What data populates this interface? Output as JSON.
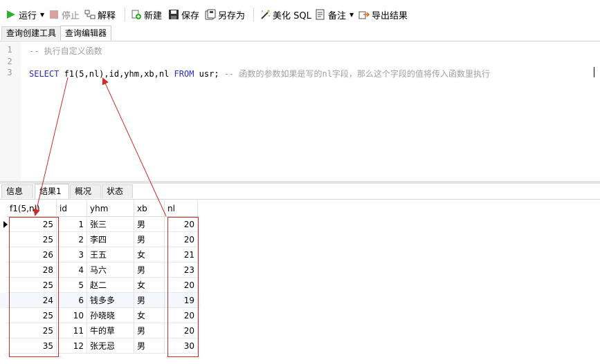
{
  "toolbar": {
    "run": "运行",
    "stop": "停止",
    "explain": "解释",
    "new": "新建",
    "save": "保存",
    "save_as": "另存为",
    "beautify": "美化 SQL",
    "notes": "备注",
    "export": "导出结果",
    "icons": [
      "play-icon",
      "stop-icon",
      "explain-icon",
      "new-icon",
      "save-icon",
      "save-as-icon",
      "wand-icon",
      "note-icon",
      "export-icon"
    ]
  },
  "editor_tabs": [
    "查询创建工具",
    "查询编辑器"
  ],
  "editor": {
    "line_numbers": [
      "1",
      "2",
      "3"
    ],
    "line1_comment": "-- 执行自定义函数",
    "line3": {
      "kw_select": "SELECT",
      "fn": " f1(",
      "arg1": "5",
      "rest": ",nl),id,yhm,xb,nl ",
      "kw_from": "FROM",
      "table": " usr; ",
      "comment": "-- 函数的参数如果是写的nl字段，那么这个字段的值将传入函数里执行"
    }
  },
  "result_tabs": [
    "信息",
    "结果1",
    "概况",
    "状态"
  ],
  "grid": {
    "columns": [
      "f1(5,nl)",
      "id",
      "yhm",
      "xb",
      "nl"
    ],
    "rows": [
      [
        "25",
        "1",
        "张三",
        "男",
        "20"
      ],
      [
        "25",
        "2",
        "李四",
        "男",
        "20"
      ],
      [
        "26",
        "3",
        "王五",
        "女",
        "21"
      ],
      [
        "28",
        "4",
        "马六",
        "男",
        "23"
      ],
      [
        "25",
        "5",
        "赵二",
        "女",
        "20"
      ],
      [
        "24",
        "6",
        "钱多多",
        "男",
        "19"
      ],
      [
        "25",
        "10",
        "孙晓晓",
        "女",
        "20"
      ],
      [
        "25",
        "11",
        "牛的草",
        "男",
        "20"
      ],
      [
        "35",
        "12",
        "张无忌",
        "男",
        "30"
      ]
    ]
  },
  "colors": {
    "annotation": "#cc2b2b",
    "keyword": "#2a2acb",
    "comment": "#a0a0a0"
  }
}
